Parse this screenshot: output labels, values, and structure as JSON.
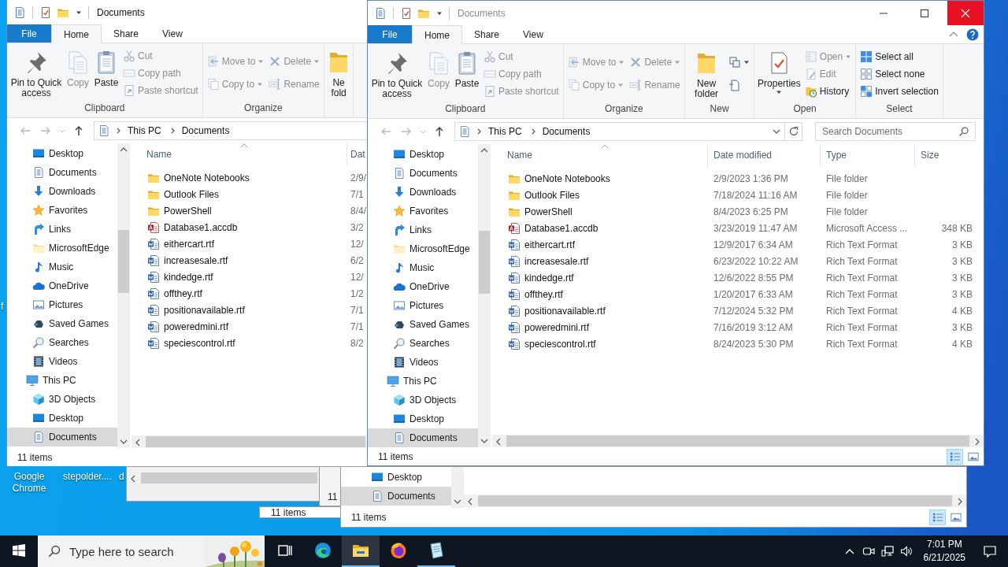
{
  "desktop": {
    "labels": [
      "Google Chrome",
      "stepolder....",
      "d",
      "f"
    ]
  },
  "background_windows": [
    {
      "kind": "scroll-strip"
    },
    {
      "kind": "status",
      "status": "11 items"
    },
    {
      "kind": "status",
      "status": "11"
    },
    {
      "kind": "explorer",
      "nav": [
        {
          "label": "Desktop",
          "kind": "desktop",
          "selected": false
        },
        {
          "label": "Documents",
          "kind": "documents",
          "selected": true
        }
      ],
      "status": "11 items",
      "view_buttons": [
        {
          "kind": "details",
          "selected": true
        },
        {
          "kind": "large-icons",
          "selected": false
        }
      ]
    }
  ],
  "windows": [
    {
      "kind": "cut",
      "title": "Documents",
      "focused": true,
      "tabs": [
        {
          "label": "File",
          "kind": "file",
          "selected": false
        },
        {
          "label": "Home",
          "kind": "tab",
          "selected": true
        },
        {
          "label": "Share",
          "kind": "tab",
          "selected": false
        },
        {
          "label": "View",
          "kind": "tab",
          "selected": false
        }
      ],
      "ribbon": [
        {
          "label": "Clipboard",
          "columns": [
            [
              {
                "kind": "pin",
                "label": "Pin to Quick access",
                "disabled": false
              }
            ],
            [
              {
                "kind": "copy",
                "label": "Copy",
                "disabled": true
              }
            ],
            [
              {
                "kind": "paste",
                "label": "Paste",
                "disabled": false
              }
            ],
            [
              {
                "kind": "cut",
                "label": "Cut",
                "disabled": true
              },
              {
                "kind": "copy-path",
                "label": "Copy path",
                "disabled": true
              },
              {
                "kind": "paste-shortcut",
                "label": "Paste shortcut",
                "disabled": true
              }
            ]
          ]
        },
        {
          "label": "Organize",
          "columns": [
            [
              {
                "kind": "move-to",
                "label": "Move to",
                "disabled": true
              },
              {
                "kind": "copy-to",
                "label": "Copy to",
                "disabled": true
              }
            ],
            [
              {
                "kind": "delete",
                "label": "Delete",
                "disabled": true
              },
              {
                "kind": "rename",
                "label": "Rename",
                "disabled": true
              }
            ]
          ]
        },
        {
          "columns": [
            [
              {
                "kind": "new-folder",
                "label": "Ne fold",
                "disabled": false
              }
            ]
          ]
        }
      ],
      "address": [
        "This PC",
        "Documents"
      ],
      "nav": [
        {
          "label": "Desktop",
          "kind": "desktop",
          "selected": false
        },
        {
          "label": "Documents",
          "kind": "documents",
          "selected": false
        },
        {
          "label": "Downloads",
          "kind": "downloads",
          "selected": false
        },
        {
          "label": "Favorites",
          "kind": "favorites",
          "selected": false
        },
        {
          "label": "Links",
          "kind": "links",
          "selected": false
        },
        {
          "label": "MicrosoftEdge",
          "kind": "pale-folder",
          "selected": false
        },
        {
          "label": "Music",
          "kind": "music",
          "selected": false
        },
        {
          "label": "OneDrive",
          "kind": "onedrive",
          "selected": false
        },
        {
          "label": "Pictures",
          "kind": "pictures",
          "selected": false
        },
        {
          "label": "Saved Games",
          "kind": "saved-games",
          "selected": false
        },
        {
          "label": "Searches",
          "kind": "searches",
          "selected": false
        },
        {
          "label": "Videos",
          "kind": "videos",
          "selected": false
        },
        {
          "label": "This PC",
          "kind": "this-pc",
          "selected": false,
          "children": [
            {
              "label": "3D Objects",
              "kind": "cube",
              "selected": false
            },
            {
              "label": "Desktop",
              "kind": "desktop",
              "selected": false
            },
            {
              "label": "Documents",
              "kind": "documents",
              "selected": true
            }
          ]
        }
      ],
      "columns": [
        {
          "label": "Name",
          "kind": "name",
          "sorted": true
        },
        {
          "label": "Dat",
          "kind": "date",
          "sorted": false
        }
      ],
      "rows": [
        {
          "kind": "folder",
          "name": "OneNote Notebooks",
          "date": "2/9/"
        },
        {
          "kind": "folder",
          "name": "Outlook Files",
          "date": "7/1"
        },
        {
          "kind": "folder",
          "name": "PowerShell",
          "date": "8/4/"
        },
        {
          "kind": "accdb",
          "name": "Database1.accdb",
          "date": "3/2"
        },
        {
          "kind": "rtf",
          "name": "eithercart.rtf",
          "date": "12/"
        },
        {
          "kind": "rtf",
          "name": "increasesale.rtf",
          "date": "6/2"
        },
        {
          "kind": "rtf",
          "name": "kindedge.rtf",
          "date": "12/"
        },
        {
          "kind": "rtf",
          "name": "offthey.rtf",
          "date": "1/2"
        },
        {
          "kind": "rtf",
          "name": "positionavailable.rtf",
          "date": "7/1"
        },
        {
          "kind": "rtf",
          "name": "poweredmini.rtf",
          "date": "7/1"
        },
        {
          "kind": "rtf",
          "name": "speciescontrol.rtf",
          "date": "8/2"
        }
      ],
      "status": "11 items"
    },
    {
      "kind": "full",
      "title": "Documents",
      "focused": false,
      "tabs": [
        {
          "label": "File",
          "kind": "file",
          "selected": false
        },
        {
          "label": "Home",
          "kind": "tab",
          "selected": true
        },
        {
          "label": "Share",
          "kind": "tab",
          "selected": false
        },
        {
          "label": "View",
          "kind": "tab",
          "selected": false
        }
      ],
      "ribbon": [
        {
          "label": "Clipboard",
          "columns": [
            [
              {
                "kind": "pin",
                "label": "Pin to Quick access",
                "disabled": false
              }
            ],
            [
              {
                "kind": "copy",
                "label": "Copy",
                "disabled": true
              }
            ],
            [
              {
                "kind": "paste",
                "label": "Paste",
                "disabled": false
              }
            ],
            [
              {
                "kind": "cut",
                "label": "Cut",
                "disabled": true
              },
              {
                "kind": "copy-path",
                "label": "Copy path",
                "disabled": true
              },
              {
                "kind": "paste-shortcut",
                "label": "Paste shortcut",
                "disabled": true
              }
            ]
          ]
        },
        {
          "label": "Organize",
          "columns": [
            [
              {
                "kind": "move-to",
                "label": "Move to",
                "disabled": true
              },
              {
                "kind": "copy-to",
                "label": "Copy to",
                "disabled": true
              }
            ],
            [
              {
                "kind": "delete",
                "label": "Delete",
                "disabled": true
              },
              {
                "kind": "rename",
                "label": "Rename",
                "disabled": true
              }
            ]
          ]
        },
        {
          "label": "New",
          "columns": [
            [
              {
                "kind": "new-folder",
                "label": "New folder",
                "disabled": false
              }
            ],
            [
              {
                "kind": "new-item",
                "disabled": false
              },
              {
                "kind": "easy-access",
                "disabled": false
              }
            ]
          ]
        },
        {
          "label": "Open",
          "columns": [
            [
              {
                "kind": "properties",
                "label": "Properties",
                "disabled": false
              }
            ],
            [
              {
                "kind": "open",
                "label": "Open",
                "disabled": true
              },
              {
                "kind": "edit",
                "label": "Edit",
                "disabled": true
              },
              {
                "kind": "history",
                "label": "History",
                "disabled": false
              }
            ]
          ]
        },
        {
          "label": "Select",
          "columns": [
            [
              {
                "kind": "select-all",
                "label": "Select all",
                "disabled": false
              },
              {
                "kind": "select-none",
                "label": "Select none",
                "disabled": false
              },
              {
                "kind": "invert-selection",
                "label": "Invert selection",
                "disabled": false
              }
            ]
          ]
        }
      ],
      "address": [
        "This PC",
        "Documents"
      ],
      "search": {
        "placeholder": "Search Documents"
      },
      "nav": [
        {
          "label": "Desktop",
          "kind": "desktop",
          "selected": false
        },
        {
          "label": "Documents",
          "kind": "documents",
          "selected": false
        },
        {
          "label": "Downloads",
          "kind": "downloads",
          "selected": false
        },
        {
          "label": "Favorites",
          "kind": "favorites",
          "selected": false
        },
        {
          "label": "Links",
          "kind": "links",
          "selected": false
        },
        {
          "label": "MicrosoftEdge",
          "kind": "pale-folder",
          "selected": false
        },
        {
          "label": "Music",
          "kind": "music",
          "selected": false
        },
        {
          "label": "OneDrive",
          "kind": "onedrive",
          "selected": false
        },
        {
          "label": "Pictures",
          "kind": "pictures",
          "selected": false
        },
        {
          "label": "Saved Games",
          "kind": "saved-games",
          "selected": false
        },
        {
          "label": "Searches",
          "kind": "searches",
          "selected": false
        },
        {
          "label": "Videos",
          "kind": "videos",
          "selected": false
        },
        {
          "label": "This PC",
          "kind": "this-pc",
          "selected": false,
          "children": [
            {
              "label": "3D Objects",
              "kind": "cube",
              "selected": false
            },
            {
              "label": "Desktop",
              "kind": "desktop",
              "selected": false
            },
            {
              "label": "Documents",
              "kind": "documents",
              "selected": true
            }
          ]
        }
      ],
      "columns": [
        {
          "label": "Name",
          "kind": "name",
          "sorted": true
        },
        {
          "label": "Date modified",
          "kind": "date",
          "sorted": false
        },
        {
          "label": "Type",
          "kind": "type",
          "sorted": false
        },
        {
          "label": "Size",
          "kind": "size",
          "sorted": false
        }
      ],
      "rows": [
        {
          "kind": "folder",
          "name": "OneNote Notebooks",
          "date": "2/9/2023 1:36 PM",
          "type": "File folder"
        },
        {
          "kind": "folder",
          "name": "Outlook Files",
          "date": "7/18/2024 11:16 AM",
          "type": "File folder"
        },
        {
          "kind": "folder",
          "name": "PowerShell",
          "date": "8/4/2023 6:25 PM",
          "type": "File folder"
        },
        {
          "kind": "accdb",
          "name": "Database1.accdb",
          "date": "3/23/2019 11:47 AM",
          "type": "Microsoft Access ...",
          "size": "348 KB"
        },
        {
          "kind": "rtf",
          "name": "eithercart.rtf",
          "date": "12/9/2017 6:34 AM",
          "type": "Rich Text Format",
          "size": "3 KB"
        },
        {
          "kind": "rtf",
          "name": "increasesale.rtf",
          "date": "6/23/2022 10:22 AM",
          "type": "Rich Text Format",
          "size": "3 KB"
        },
        {
          "kind": "rtf",
          "name": "kindedge.rtf",
          "date": "12/6/2022 8:55 PM",
          "type": "Rich Text Format",
          "size": "3 KB"
        },
        {
          "kind": "rtf",
          "name": "offthey.rtf",
          "date": "1/20/2017 6:33 AM",
          "type": "Rich Text Format",
          "size": "3 KB"
        },
        {
          "kind": "rtf",
          "name": "positionavailable.rtf",
          "date": "7/12/2024 5:32 PM",
          "type": "Rich Text Format",
          "size": "4 KB"
        },
        {
          "kind": "rtf",
          "name": "poweredmini.rtf",
          "date": "7/16/2019 3:12 AM",
          "type": "Rich Text Format",
          "size": "3 KB"
        },
        {
          "kind": "rtf",
          "name": "speciescontrol.rtf",
          "date": "8/24/2023 5:30 PM",
          "type": "Rich Text Format",
          "size": "4 KB"
        }
      ],
      "status": "11 items",
      "view_buttons": [
        {
          "kind": "details",
          "selected": true
        },
        {
          "kind": "large-icons",
          "selected": false
        }
      ]
    }
  ],
  "taskbar": {
    "search": {
      "placeholder": "Type here to search"
    },
    "apps": [
      {
        "kind": "edge",
        "running": false,
        "selected": false
      },
      {
        "kind": "explorer",
        "running": true,
        "selected": true
      },
      {
        "kind": "firefox",
        "running": false,
        "selected": false
      },
      {
        "kind": "notepad",
        "running": true,
        "selected": false
      }
    ],
    "clock": {
      "time": "7:01 PM",
      "date": "6/21/2025"
    }
  }
}
